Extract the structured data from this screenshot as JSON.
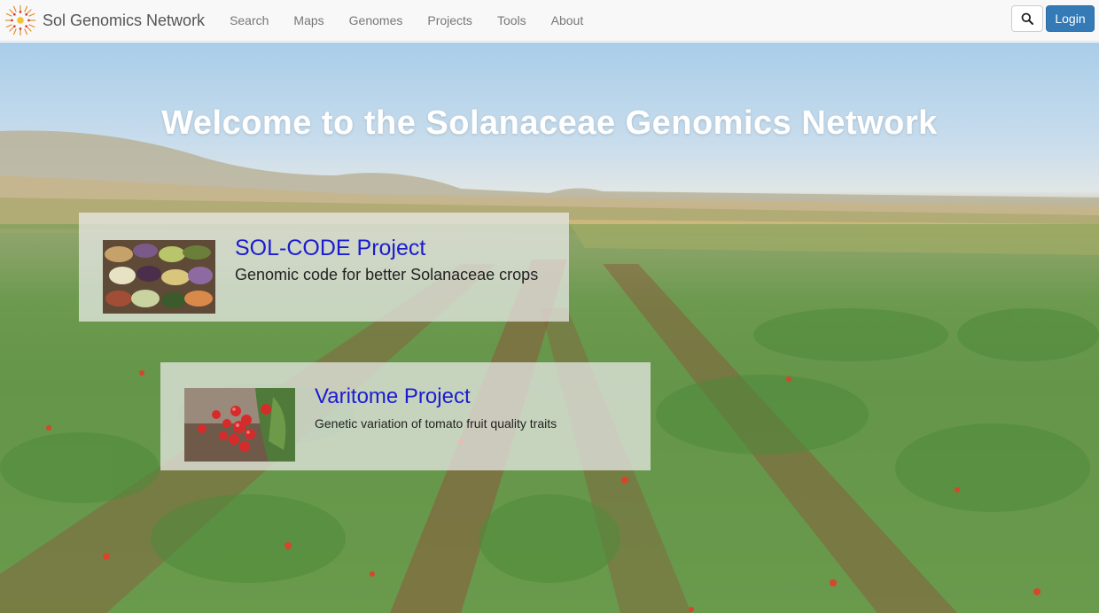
{
  "brand": {
    "name": "Sol Genomics Network",
    "logo_icon": "sun-logo-icon"
  },
  "nav": {
    "links": [
      {
        "label": "Search"
      },
      {
        "label": "Maps"
      },
      {
        "label": "Genomes"
      },
      {
        "label": "Projects"
      },
      {
        "label": "Tools"
      },
      {
        "label": "About"
      }
    ],
    "search_icon": "search-icon",
    "login_label": "Login"
  },
  "hero": {
    "title": "Welcome to the Solanaceae Genomics Network"
  },
  "projects": [
    {
      "title": "SOL-CODE Project",
      "subtitle": "Genomic code for better Solanaceae crops",
      "image": "eggplant-varieties-image"
    },
    {
      "title": "Varitome Project",
      "subtitle": "Genetic variation of tomato fruit quality traits",
      "image": "cherry-tomatoes-image"
    }
  ],
  "colors": {
    "accent": "#337ab7",
    "link": "#1c1cd1",
    "navbar_bg": "#f8f8f8"
  }
}
